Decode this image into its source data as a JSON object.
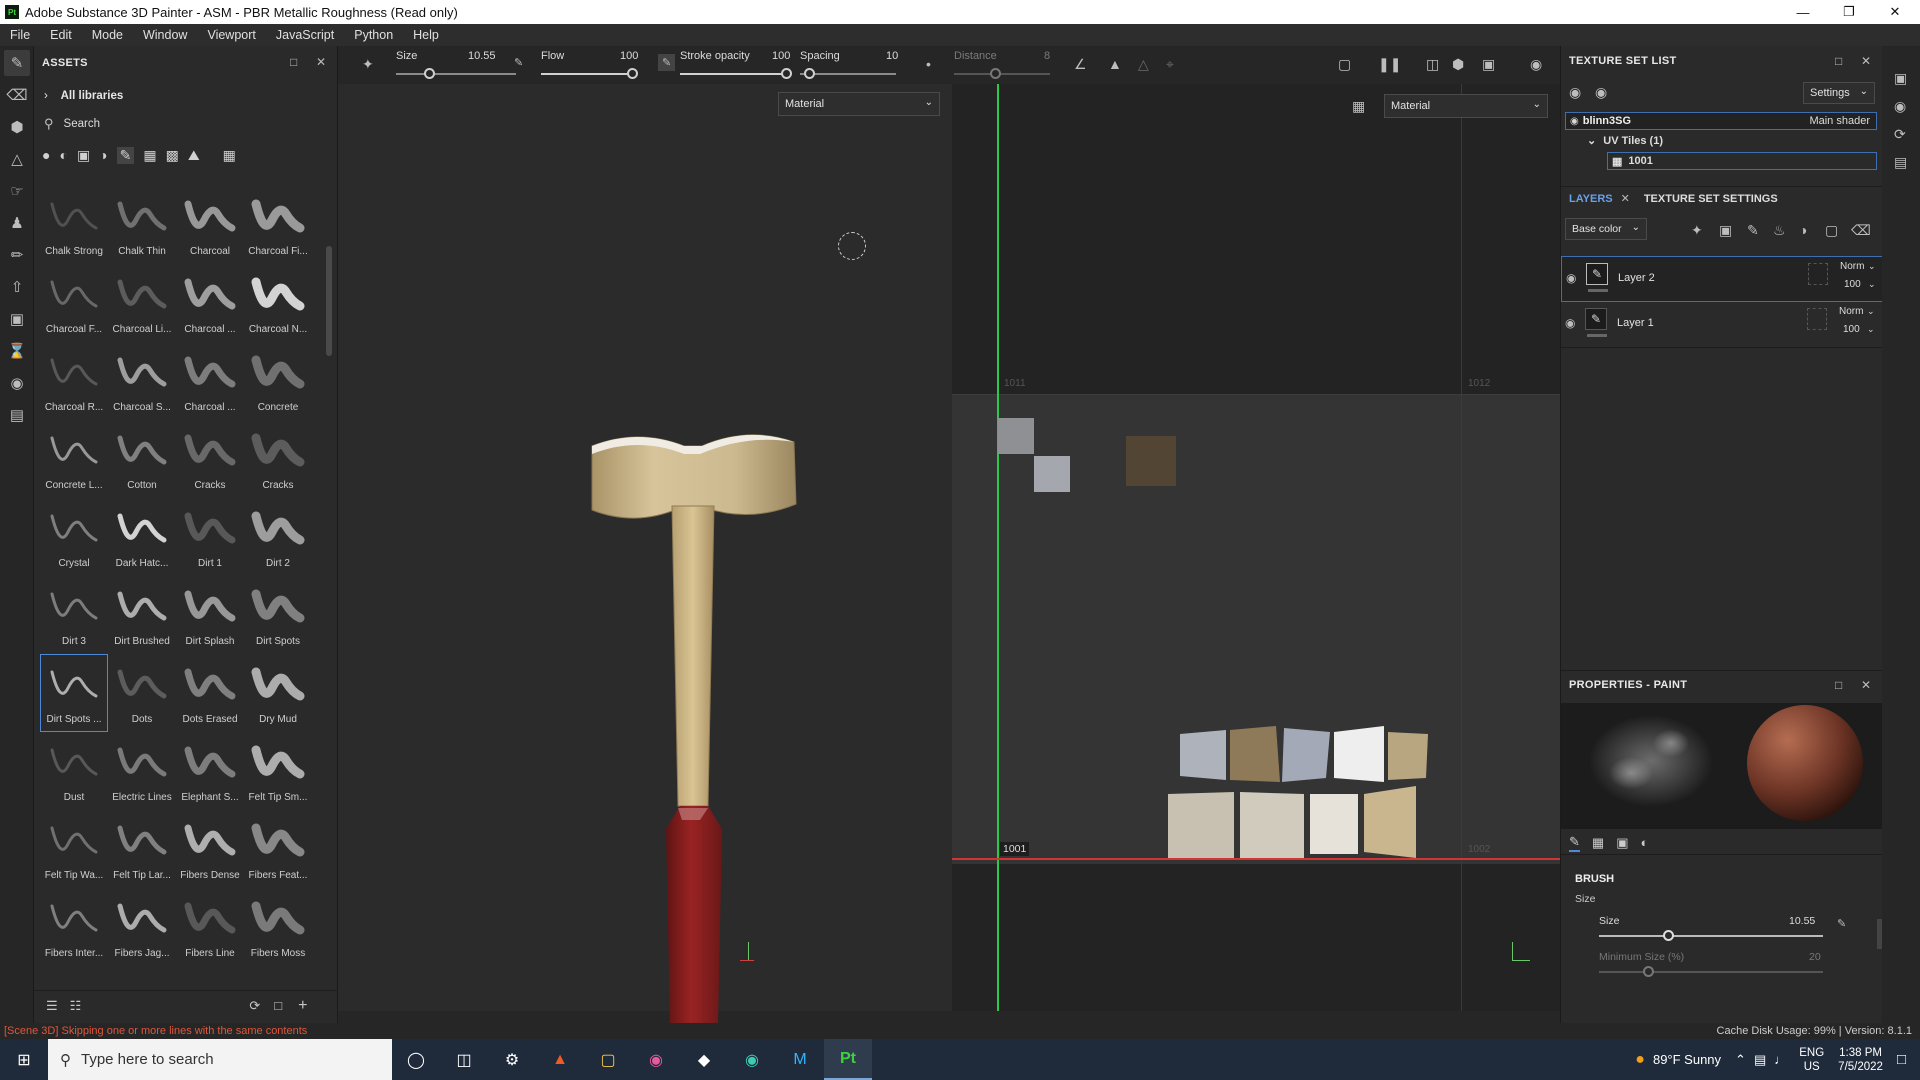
{
  "app": {
    "title": "Adobe Substance 3D Painter - ASM - PBR Metallic Roughness (Read only)",
    "logo": "Pt"
  },
  "menu": [
    "File",
    "Edit",
    "Mode",
    "Window",
    "Viewport",
    "JavaScript",
    "Python",
    "Help"
  ],
  "assets": {
    "title": "ASSETS",
    "breadcrumb": "All libraries",
    "search_placeholder": "Search",
    "brushes": [
      "Chalk Strong",
      "Chalk Thin",
      "Charcoal",
      "Charcoal Fi...",
      "Charcoal F...",
      "Charcoal Li...",
      "Charcoal ...",
      "Charcoal N...",
      "Charcoal R...",
      "Charcoal S...",
      "Charcoal ...",
      "Concrete",
      "Concrete L...",
      "Cotton",
      "Cracks",
      "Cracks",
      "Crystal",
      "Dark Hatc...",
      "Dirt 1",
      "Dirt 2",
      "Dirt 3",
      "Dirt Brushed",
      "Dirt Splash",
      "Dirt Spots",
      "Dirt Spots ...",
      "Dots",
      "Dots Erased",
      "Dry Mud",
      "Dust",
      "Electric Lines",
      "Elephant S...",
      "Felt Tip Sm...",
      "Felt Tip Wa...",
      "Felt Tip Lar...",
      "Fibers Dense",
      "Fibers Feat...",
      "Fibers Inter...",
      "Fibers Jag...",
      "Fibers Line",
      "Fibers Moss"
    ],
    "selected_brush": "Dirt Spots ..."
  },
  "tool_options": {
    "size_label": "Size",
    "size_value": "10.55",
    "flow_label": "Flow",
    "flow_value": "100",
    "stroke_opacity_label": "Stroke opacity",
    "stroke_opacity_value": "100",
    "spacing_label": "Spacing",
    "spacing_value": "10",
    "distance_label": "Distance",
    "distance_value": "8"
  },
  "viewport3d": {
    "mode_dropdown": "Material"
  },
  "viewport2d": {
    "mode_dropdown": "Material",
    "tile_labels": {
      "t1011": "1011",
      "t1012": "1012",
      "t1001": "1001",
      "t1002": "1002"
    }
  },
  "texture_set_list": {
    "title": "TEXTURE SET LIST",
    "settings": "Settings",
    "set_name": "blinn3SG",
    "shader": "Main shader",
    "uv_tiles": "UV Tiles (1)",
    "tile": "1001"
  },
  "layers": {
    "tab_layers": "LAYERS",
    "tab_tss": "TEXTURE SET SETTINGS",
    "channel": "Base color",
    "items": [
      {
        "name": "Layer 2",
        "blend": "Norm",
        "opacity": "100"
      },
      {
        "name": "Layer 1",
        "blend": "Norm",
        "opacity": "100"
      }
    ]
  },
  "properties": {
    "title": "PROPERTIES - PAINT",
    "section": "BRUSH",
    "size_group": "Size",
    "size_label": "Size",
    "size_value": "10.55",
    "min_size_label": "Minimum Size (%)",
    "min_size_value": "20"
  },
  "status": {
    "message": "[Scene 3D] Skipping one or more lines with the same contents",
    "cache": "Cache Disk Usage:  99% | Version: 8.1.1"
  },
  "taskbar": {
    "search_placeholder": "Type here to search",
    "weather": "89°F  Sunny",
    "lang1": "ENG",
    "lang2": "US",
    "time": "1:38 PM",
    "date": "7/5/2022"
  },
  "colors": {
    "accent": "#4f89d6",
    "handle_red": "#8a1f1f",
    "wood": "#c8b382",
    "taskbar": "#1f2a3a"
  }
}
